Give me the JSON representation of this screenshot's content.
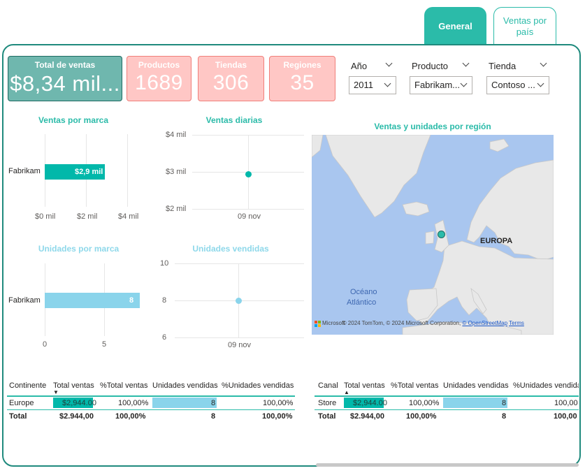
{
  "tabs": [
    {
      "label": "General"
    },
    {
      "label": "Ventas por país"
    }
  ],
  "kpis": {
    "total": {
      "label": "Total de ventas",
      "value": "$8,34 mil..."
    },
    "productos": {
      "label": "Productos",
      "value": "1689"
    },
    "tiendas": {
      "label": "Tiendas",
      "value": "306"
    },
    "regiones": {
      "label": "Regiones",
      "value": "35"
    }
  },
  "slicers": {
    "year": {
      "label": "Año",
      "value": "2011"
    },
    "product": {
      "label": "Producto",
      "value": "Fabrikam..."
    },
    "store": {
      "label": "Tienda",
      "value": "Contoso ..."
    }
  },
  "ventas_marca": {
    "title": "Ventas por marca",
    "category": "Fabrikam",
    "data_label": "$2,9 mil",
    "ticks": [
      "$0 mil",
      "$2 mil",
      "$4 mil"
    ],
    "chart_data": {
      "type": "bar",
      "categories": [
        "Fabrikam"
      ],
      "values": [
        2.9
      ],
      "xlim": [
        0,
        4
      ]
    }
  },
  "ventas_diarias": {
    "title": "Ventas diarias",
    "yticks": [
      "$4 mil",
      "$3 mil",
      "$2 mil"
    ],
    "xtick": "09 nov",
    "chart_data": {
      "type": "scatter",
      "x": [
        "09 nov"
      ],
      "y": [
        2.94
      ],
      "ylim": [
        2,
        4
      ]
    }
  },
  "map": {
    "title": "Ventas y unidades por región",
    "region_label": "EUROPA",
    "ocean_label_1": "Océano",
    "ocean_label_2": "Atlántico",
    "logo_text": "Microsoft",
    "attribution_1": "© 2024 TomTom, © 2024 Microsoft Corporation,",
    "attribution_link": "© OpenStreetMap",
    "attribution_terms": "Terms",
    "colors": {
      "water": "#a9c6ef",
      "land": "#e8e8e8",
      "marker": "#2bbba9"
    }
  },
  "unidades_marca": {
    "title": "Unidades por marca",
    "category": "Fabrikam",
    "data_label": "8",
    "ticks": [
      "0",
      "5"
    ],
    "chart_data": {
      "type": "bar",
      "categories": [
        "Fabrikam"
      ],
      "values": [
        8
      ],
      "xlim": [
        0,
        8
      ]
    }
  },
  "unidades_vendidas": {
    "title": "Unidades vendidas",
    "yticks": [
      "10",
      "8",
      "6"
    ],
    "xtick": "09 nov",
    "chart_data": {
      "type": "scatter",
      "x": [
        "09 nov"
      ],
      "y": [
        8
      ],
      "ylim": [
        6,
        10
      ]
    }
  },
  "table_continent": {
    "headers": [
      "Continente",
      "Total ventas",
      "%Total ventas",
      "Unidades vendidas",
      "%Unidades vendidas"
    ],
    "row": [
      "Europe",
      "$2,944.00",
      "100,00%",
      "8",
      "100,00%"
    ],
    "total": [
      "Total",
      "$2.944,00",
      "100,00%",
      "8",
      "100,00%"
    ]
  },
  "table_channel": {
    "headers": [
      "Canal",
      "Total ventas",
      "%Total ventas",
      "Unidades vendidas",
      "%Unidades vendidas"
    ],
    "row": [
      "Store",
      "$2,944.00",
      "100,00%",
      "8",
      "100,00"
    ],
    "total": [
      "Total",
      "$2.944,00",
      "100,00%",
      "8",
      "100,00"
    ]
  },
  "colors": {
    "accent": "#2bbba9",
    "kpi_main": "#6fb7ae",
    "kpi_pink": "#ffc7c5",
    "bar_teal": "#01b8aa",
    "bar_blue": "#8ad4eb"
  }
}
